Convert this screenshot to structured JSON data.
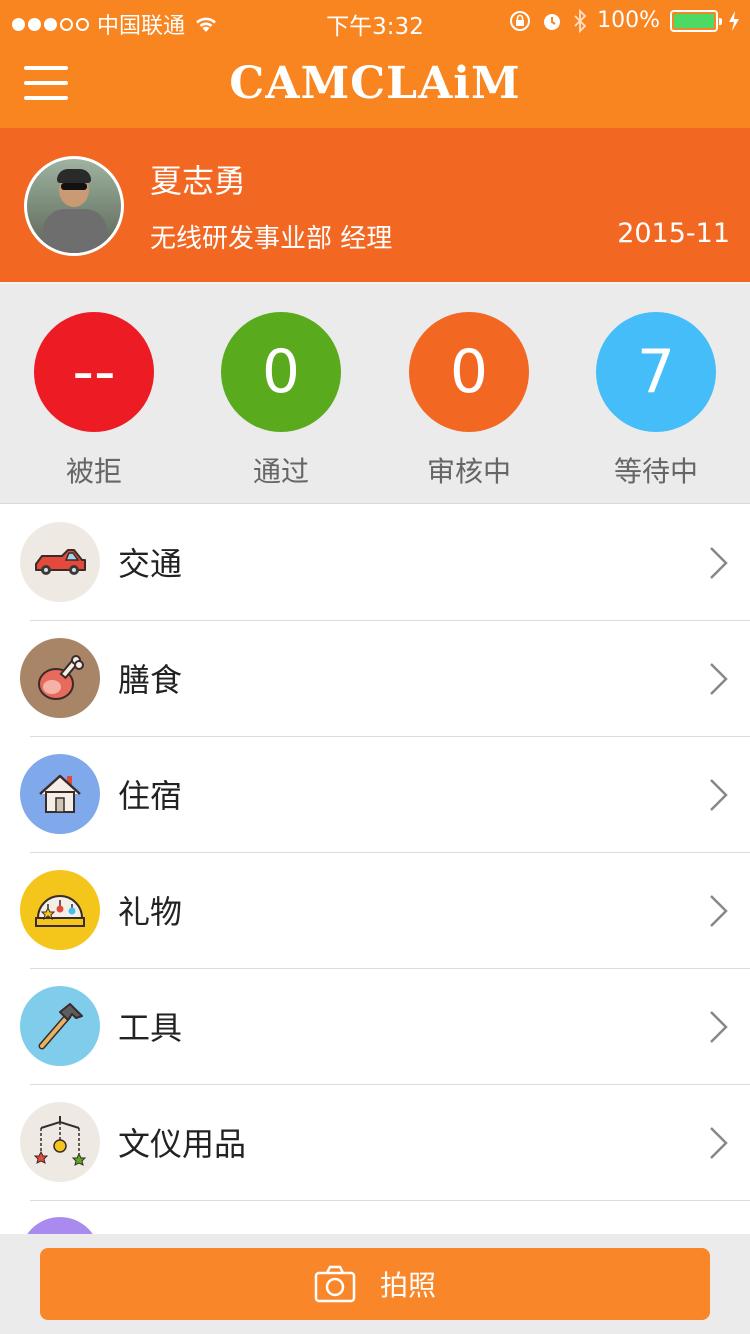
{
  "status_bar": {
    "carrier": "中国联通",
    "time": "下午3:32",
    "battery": "100%"
  },
  "navbar": {
    "logo": "CAMCLAiM"
  },
  "profile": {
    "name": "夏志勇",
    "department": "无线研发事业部 经理",
    "period": "2015-11"
  },
  "stats": [
    {
      "value": "--",
      "label": "被拒",
      "color": "#ED1C24"
    },
    {
      "value": "0",
      "label": "通过",
      "color": "#5AAA1E"
    },
    {
      "value": "0",
      "label": "审核中",
      "color": "#F26722"
    },
    {
      "value": "7",
      "label": "等待中",
      "color": "#45BDF8"
    }
  ],
  "categories": [
    {
      "label": "交通",
      "icon": "car-icon",
      "bg": "#EEEAE3"
    },
    {
      "label": "膳食",
      "icon": "meat-icon",
      "bg": "#A98568"
    },
    {
      "label": "住宿",
      "icon": "house-icon",
      "bg": "#7FA9EB"
    },
    {
      "label": "礼物",
      "icon": "gift-icon",
      "bg": "#F4C51B"
    },
    {
      "label": "工具",
      "icon": "hammer-icon",
      "bg": "#7FCDEB"
    },
    {
      "label": "文仪用品",
      "icon": "stationery-icon",
      "bg": "#EEEAE3"
    }
  ],
  "bottom": {
    "photo_label": "拍照"
  }
}
